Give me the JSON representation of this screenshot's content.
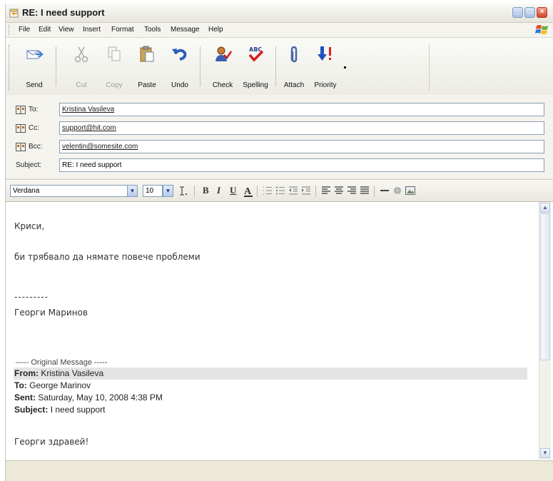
{
  "window": {
    "title": "RE: I need support"
  },
  "menu": [
    "File",
    "Edit",
    "View",
    "Insert",
    "Format",
    "Tools",
    "Message",
    "Help"
  ],
  "toolbar": {
    "send": "Send",
    "cut": "Cut",
    "copy": "Copy",
    "paste": "Paste",
    "undo": "Undo",
    "check": "Check",
    "spelling": "Spelling",
    "attach": "Attach",
    "priority": "Priority"
  },
  "address": {
    "to_label": "To:",
    "to_value": "Kristina Vasileva",
    "cc_label": "Cc:",
    "cc_value": "support@hit.com",
    "bcc_label": "Bcc:",
    "bcc_value": "velentin@somesite.com",
    "subject_label": "Subject:",
    "subject_value": "RE: I need support"
  },
  "format": {
    "font": "Verdana",
    "size": "10"
  },
  "body": {
    "greeting": "Криси,",
    "line1": "би трябвало да нямате повече проблеми",
    "separator": "---------",
    "signature": "Георги Маринов",
    "original_header": "----- Original Message -----",
    "from_label": "From:",
    "from_value": "Kristina Vasileva",
    "to_label": "To:",
    "to_value": "George Marinov",
    "sent_label": "Sent:",
    "sent_value": "Saturday, May 10, 2008 4:38 PM",
    "subject_label": "Subject:",
    "subject_value": "I need support",
    "quoted_first": "Георги здравей!"
  }
}
